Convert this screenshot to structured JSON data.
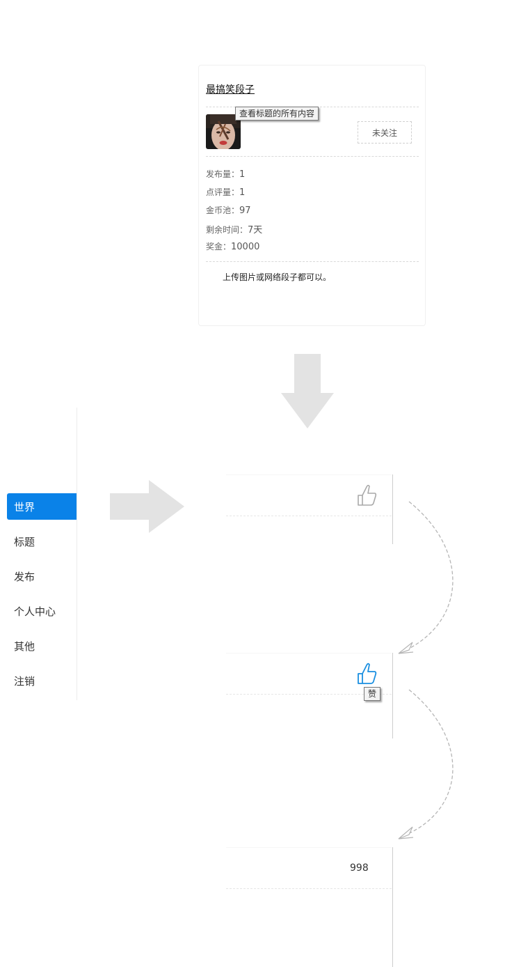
{
  "card": {
    "title": "最搞笑段子",
    "tooltip": "查看标题的所有内容",
    "follow_label": "未关注",
    "stats": [
      {
        "label": "发布量：",
        "value": "1"
      },
      {
        "label": "点评量：",
        "value": "1"
      },
      {
        "label": "金币池：",
        "value": "97"
      },
      {
        "label": "剩余时间：",
        "value": "7天"
      },
      {
        "label": "奖金：",
        "value": "10000"
      }
    ],
    "description": "上传图片或网络段子都可以。"
  },
  "sidebar": {
    "items": [
      {
        "label": "世界",
        "active": true
      },
      {
        "label": "标题"
      },
      {
        "label": "发布"
      },
      {
        "label": "个人中心"
      },
      {
        "label": "其他"
      },
      {
        "label": "注销"
      }
    ]
  },
  "like_demo": {
    "step1_icon": "thumbs-up-outline-icon",
    "step2_icon": "thumbs-up-active-icon",
    "step2_tooltip": "赞",
    "step3_count": "998",
    "colors": {
      "active": "#1a8fe0",
      "inactive": "#a9a9a9",
      "arrow": "#e0e0e0"
    }
  }
}
